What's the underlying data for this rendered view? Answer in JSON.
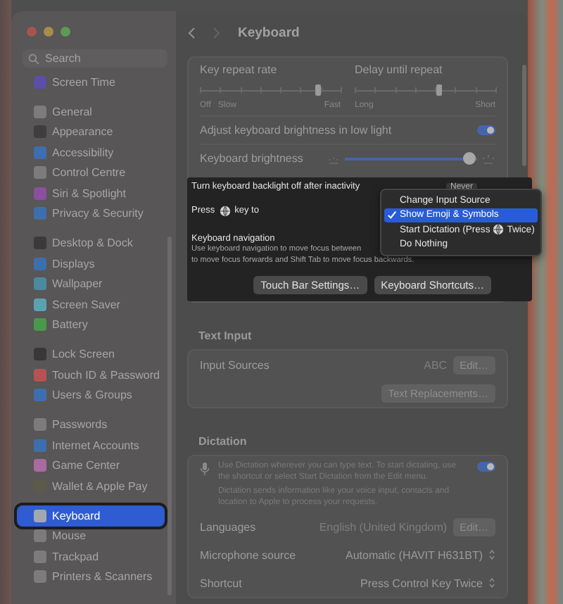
{
  "search": {
    "placeholder": "Search"
  },
  "sidebar": {
    "groups": [
      [
        {
          "label": "Screen Time",
          "color": "#5b4fa8",
          "selected": false
        }
      ],
      [
        {
          "label": "General",
          "color": "#7c7c7c",
          "selected": false
        },
        {
          "label": "Appearance",
          "color": "#3e3e3e",
          "selected": false
        },
        {
          "label": "Accessibility",
          "color": "#3d6fae",
          "selected": false
        },
        {
          "label": "Control Centre",
          "color": "#7c7c7c",
          "selected": false
        },
        {
          "label": "Siri & Spotlight",
          "color": "#8a4f9e",
          "selected": false
        },
        {
          "label": "Privacy & Security",
          "color": "#3d6fae",
          "selected": false
        }
      ],
      [
        {
          "label": "Desktop & Dock",
          "color": "#3a3a3a",
          "selected": false
        },
        {
          "label": "Displays",
          "color": "#3d6fae",
          "selected": false
        },
        {
          "label": "Wallpaper",
          "color": "#4b8ba0",
          "selected": false
        },
        {
          "label": "Screen Saver",
          "color": "#5aa2b2",
          "selected": false
        },
        {
          "label": "Battery",
          "color": "#4b974b",
          "selected": false
        }
      ],
      [
        {
          "label": "Lock Screen",
          "color": "#383838",
          "selected": false
        },
        {
          "label": "Touch ID & Password",
          "color": "#b85252",
          "selected": false
        },
        {
          "label": "Users & Groups",
          "color": "#3d6fae",
          "selected": false
        }
      ],
      [
        {
          "label": "Passwords",
          "color": "#7c7c7c",
          "selected": false
        },
        {
          "label": "Internet Accounts",
          "color": "#3d6fae",
          "selected": false
        },
        {
          "label": "Game Center",
          "color": "#a86aa0",
          "selected": false
        },
        {
          "label": "Wallet & Apple Pay",
          "color": "#5c5a48",
          "selected": false
        }
      ],
      [
        {
          "label": "Keyboard",
          "color": "#a3a8b0",
          "selected": true
        },
        {
          "label": "Mouse",
          "color": "#7c7c7c",
          "selected": false
        },
        {
          "label": "Trackpad",
          "color": "#7c7c7c",
          "selected": false
        },
        {
          "label": "Printers & Scanners",
          "color": "#7c7c7c",
          "selected": false
        }
      ]
    ]
  },
  "header": {
    "title": "Keyboard"
  },
  "key_repeat": [
    {
      "label": "Key repeat rate",
      "level": 0.84,
      "scale_start": [
        "Off",
        "Slow"
      ],
      "scale_end": "Fast"
    },
    {
      "label": "Delay until repeat",
      "level": 0.6,
      "scale_start": [
        "Long"
      ],
      "scale_end": "Short"
    }
  ],
  "adjust_brightness": {
    "label": "Adjust keyboard brightness in low light",
    "on": true
  },
  "brightness": {
    "label": "Keyboard brightness",
    "level": 0.95
  },
  "highlight_panel": {
    "backlight": {
      "label": "Turn keyboard backlight off after inactivity",
      "value": "Never"
    },
    "press_key": {
      "before": "Press",
      "after": "key to"
    },
    "navigation": {
      "title": "Keyboard navigation",
      "description": [
        "Use keyboard navigation to move focus between",
        "to move focus forwards and Shift Tab to move focus backwards."
      ]
    },
    "buttons": [
      "Touch Bar Settings…",
      "Keyboard Shortcuts…"
    ]
  },
  "menu": {
    "items": [
      {
        "label": "Change Input Source",
        "selected": false
      },
      {
        "label": "Show Emoji & Symbols",
        "selected": true
      },
      {
        "label": "Start Dictation (Press",
        "after_globe": "Twice)",
        "selected": false
      },
      {
        "label": "Do Nothing",
        "selected": false
      }
    ]
  },
  "text_input": {
    "heading": "Text Input",
    "input_sources": {
      "label": "Input Sources",
      "value": "ABC",
      "button": "Edit…"
    },
    "button": "Text Replacements…"
  },
  "dictation": {
    "heading": "Dictation",
    "description": "Use Dictation wherever you can type text. To start dictating, use the shortcut or select Start Dictation from the Edit menu.",
    "on": true,
    "note": "Dictation sends information like your voice input, contacts and location to Apple to process your requests.",
    "rows": [
      {
        "kind": "button",
        "label": "Languages",
        "value": "English (United Kingdom)",
        "button": "Edit…"
      },
      {
        "kind": "popup",
        "label": "Microphone source",
        "value": "Automatic (HAVIT H631BT)"
      },
      {
        "kind": "popup",
        "label": "Shortcut",
        "value": "Press Control Key Twice"
      }
    ]
  }
}
